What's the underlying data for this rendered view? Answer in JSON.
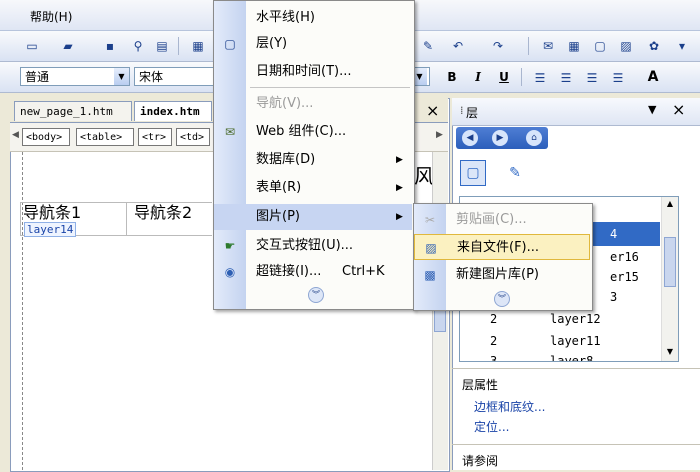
{
  "menubar": {
    "help": "帮助(H)"
  },
  "format_toolbar": {
    "style": "普通",
    "font": "宋体",
    "bold": "B",
    "italic": "I",
    "underline": "U",
    "font_size_btn": "A"
  },
  "doc": {
    "tabs": [
      "new_page_1.htm",
      "index.htm"
    ],
    "tab_close": "×",
    "tags": [
      "<body>",
      "<table>",
      "<tr>",
      "<td>"
    ],
    "nav_cells": [
      "导航条1",
      "导航条2"
    ],
    "layer_label": "layer14",
    "partial_text": "风"
  },
  "insert_menu": {
    "items": [
      {
        "label": "水平线(H)"
      },
      {
        "label": "层(Y)"
      },
      {
        "label": "日期和时间(T)..."
      },
      {
        "label": "导航(V)..."
      },
      {
        "label": "Web 组件(C)..."
      },
      {
        "label": "数据库(D)"
      },
      {
        "label": "表单(R)"
      },
      {
        "label": "图片(P)"
      },
      {
        "label": "交互式按钮(U)..."
      },
      {
        "label": "超链接(I)...",
        "shortcut": "Ctrl+K"
      }
    ]
  },
  "picture_submenu": {
    "items": [
      {
        "label": "剪贴画(C)..."
      },
      {
        "label": "来自文件(F)..."
      },
      {
        "label": "新建图片库(P)"
      }
    ]
  },
  "panel": {
    "title": "层",
    "close": "×",
    "layers": [
      {
        "z": "",
        "name": "4"
      },
      {
        "z": "",
        "name": "er16"
      },
      {
        "z": "",
        "name": "er15"
      },
      {
        "z": "",
        "name": "3"
      },
      {
        "z": "2",
        "name": "layer12"
      },
      {
        "z": "2",
        "name": "layer11"
      },
      {
        "z": "3",
        "name": "layer8"
      }
    ],
    "props_title": "层属性",
    "border_link": "边框和底纹...",
    "position_link": "定位...",
    "see_also": "请参阅"
  },
  "colors": {
    "menu_highlight": "#fbf1c1",
    "gutter": "#c4d3f0",
    "link": "#1a44a8",
    "panel_select": "#316ac5"
  }
}
